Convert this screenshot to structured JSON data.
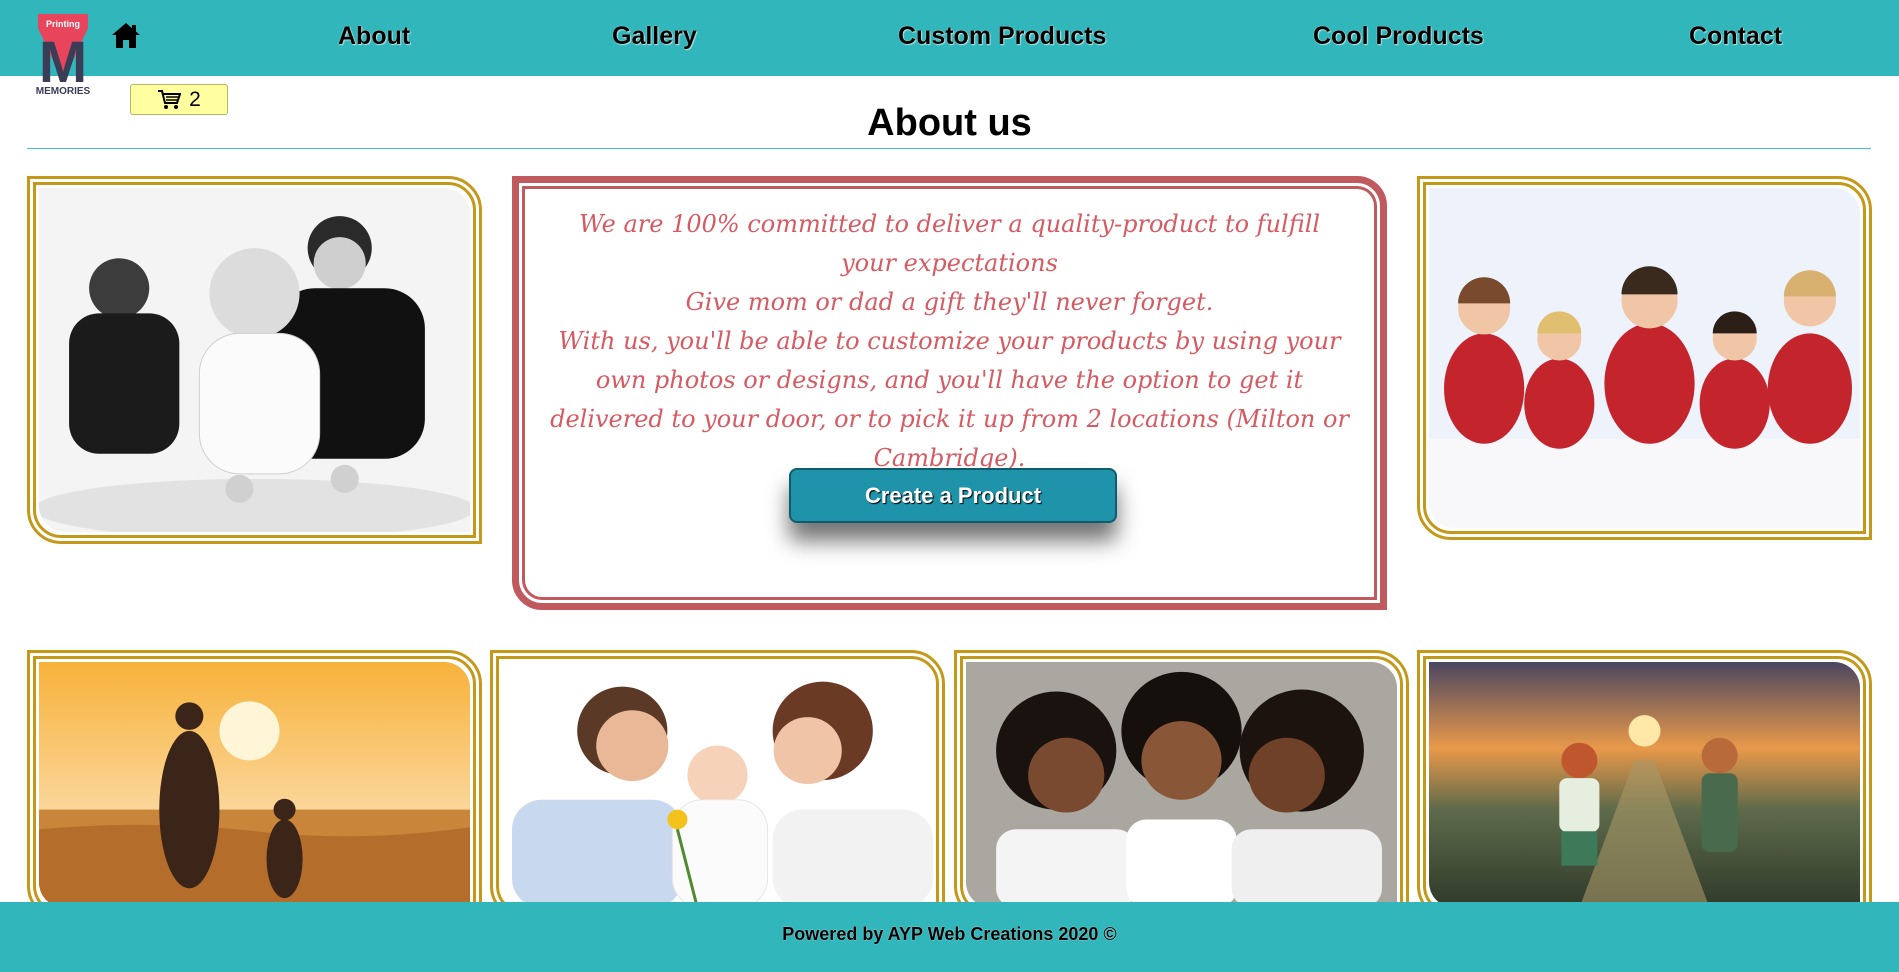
{
  "brand": {
    "logo_top_text": "Printing",
    "logo_letter": "M",
    "logo_bottom_text": "MEMORIES"
  },
  "nav": {
    "home_icon": "home-icon",
    "links": [
      "About",
      "Gallery",
      "Custom Products",
      "Cool Products",
      "Contact"
    ]
  },
  "cart": {
    "icon": "shopping-cart-icon",
    "count": "2"
  },
  "page": {
    "title": "About us"
  },
  "about": {
    "lines": [
      "We are 100% committed to deliver a quality-product to fulfill your expectations",
      "Give mom or dad a gift they'll never forget.",
      "With us, you'll be able to customize your products by using your own photos or designs, and you'll have the option to get it delivered to your door, or to pick it up from 2 locations (Milton or Cambridge)."
    ],
    "button_label": "Create a Product"
  },
  "gallery": {
    "images": [
      "family-photo-black-white",
      "family-photo-red-shirts",
      "mother-child-beach-sunset",
      "parents-with-baby-flower",
      "three-women-portrait",
      "children-holding-hands-sunset"
    ]
  },
  "colors": {
    "header": "#31b7bb",
    "frame_gold": "#c4991a",
    "panel_border": "#c05a5e",
    "panel_text": "#d65a62",
    "button": "#1f93a9",
    "cart_bg": "#ffff9f"
  },
  "footer": {
    "text": "Powered by AYP Web Creations 2020 ©"
  }
}
